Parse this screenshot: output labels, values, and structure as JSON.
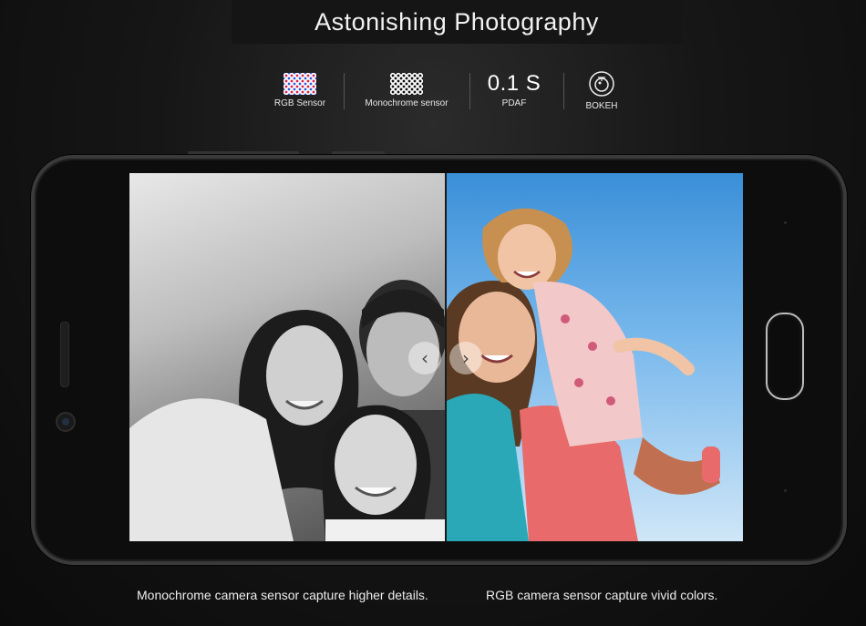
{
  "header": {
    "title": "Astonishing Photography"
  },
  "features": [
    {
      "id": "rgb",
      "icon": "rgb-sensor-icon",
      "label": "RGB Sensor"
    },
    {
      "id": "mono",
      "icon": "monochrome-sensor-icon",
      "label": "Monochrome sensor"
    },
    {
      "id": "pdaf",
      "value": "0.1 S",
      "label": "PDAF"
    },
    {
      "id": "bokeh",
      "icon": "aperture-icon",
      "label": "BOKEH"
    }
  ],
  "screen": {
    "left_photo": "monochrome-family-selfie",
    "right_photo": "color-family-selfie",
    "prev_glyph": "‹",
    "next_glyph": "›"
  },
  "captions": {
    "left": "Monochrome camera sensor capture higher details.",
    "right": "RGB camera sensor capture vivid colors."
  },
  "colors": {
    "background": "#111111",
    "text": "#ffffff",
    "sky": "#3a8fd8"
  }
}
